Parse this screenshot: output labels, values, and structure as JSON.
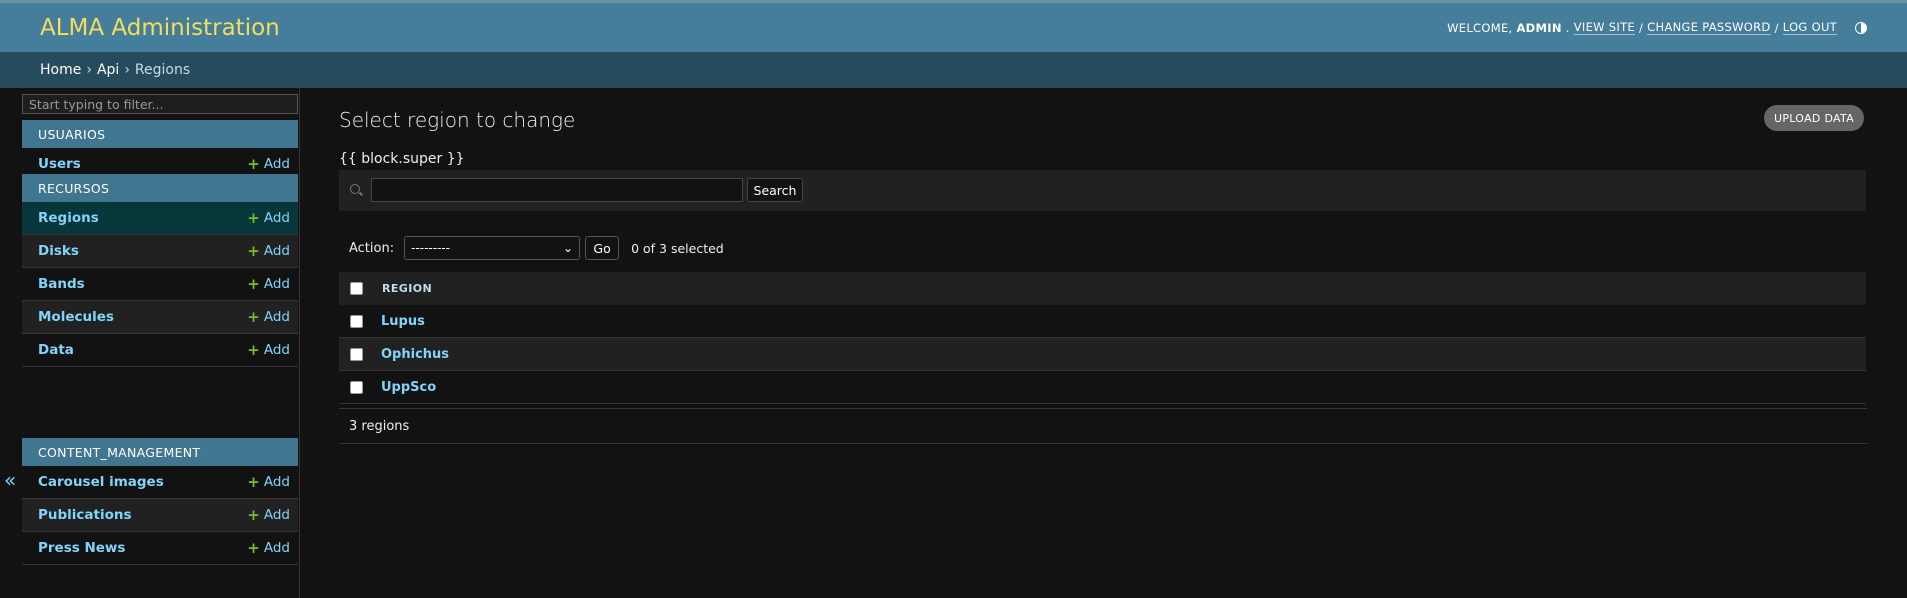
{
  "header": {
    "brand": "ALMA Administration",
    "welcome_prefix": "WELCOME,",
    "username": "ADMIN",
    "view_site": "VIEW SITE",
    "change_password": "CHANGE PASSWORD",
    "log_out": "LOG OUT",
    "separator": "/",
    "theme_icon": "theme-toggle-icon"
  },
  "breadcrumbs": [
    "Home",
    "Api",
    "Regions"
  ],
  "sidebar": {
    "filter_placeholder": "Start typing to filter...",
    "modules": [
      {
        "caption": "USUARIOS",
        "items": [
          {
            "name": "Users",
            "add": "Add"
          }
        ]
      },
      {
        "caption": "RECURSOS",
        "items": [
          {
            "name": "Regions",
            "add": "Add"
          },
          {
            "name": "Disks",
            "add": "Add"
          },
          {
            "name": "Bands",
            "add": "Add"
          },
          {
            "name": "Molecules",
            "add": "Add"
          },
          {
            "name": "Data",
            "add": "Add"
          }
        ]
      },
      {
        "caption": "CONTENT_MANAGEMENT",
        "items": [
          {
            "name": "Carousel images",
            "add": "Add"
          },
          {
            "name": "Publications",
            "add": "Add"
          },
          {
            "name": "Press News",
            "add": "Add"
          }
        ]
      }
    ],
    "collapse_glyph": "«"
  },
  "main": {
    "title": "Select region to change",
    "upload_button": "UPLOAD DATA",
    "block_super": "{{ block.super }}",
    "search_button": "Search",
    "action_label": "Action:",
    "action_value": "---------",
    "go_button": "Go",
    "selected_counter": "0 of 3 selected",
    "column_header": "REGION",
    "rows": [
      "Lupus",
      "Ophichus",
      "UppSco"
    ],
    "paginator": "3 regions"
  },
  "colors": {
    "header_bg": "#447e9b",
    "brand": "#f5dd5d",
    "breadcrumbs_bg": "#264b5d",
    "link": "#81d4fa",
    "add_plus": "#70bf2b",
    "current_row": "#07373b"
  }
}
